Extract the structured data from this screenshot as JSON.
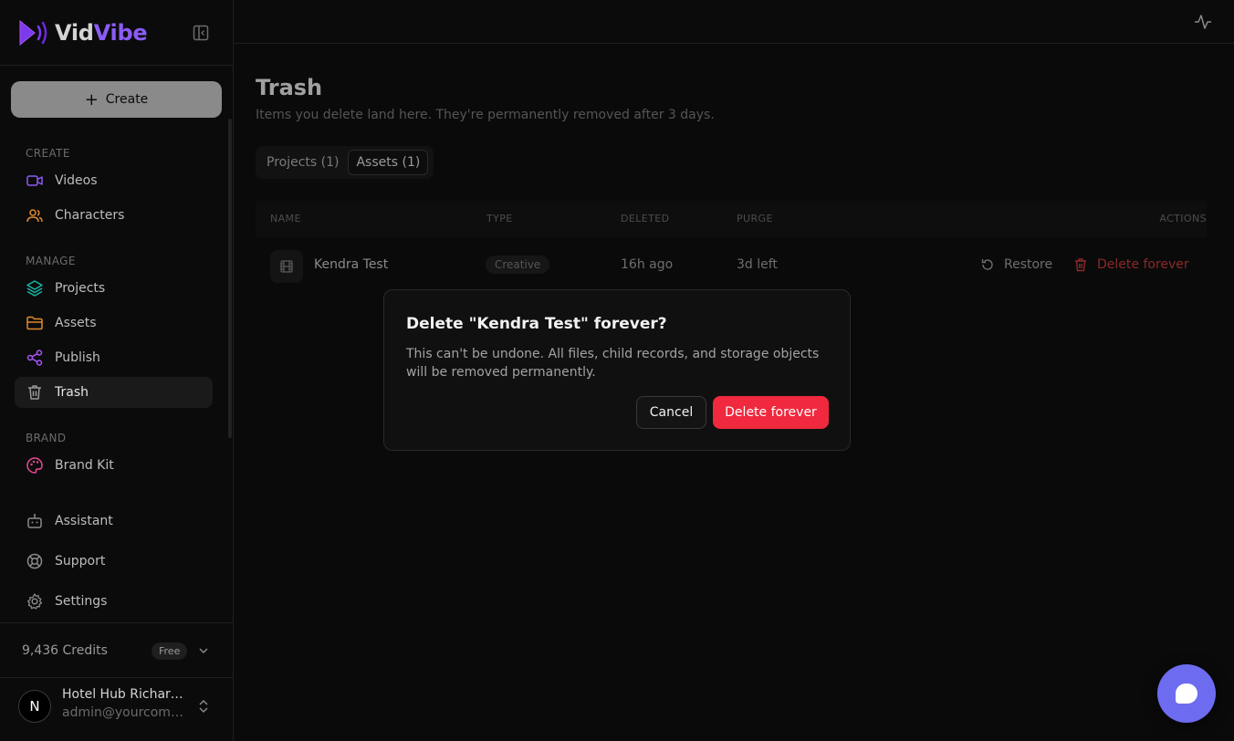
{
  "brand": {
    "name_part1": "Vid",
    "name_part2": "Vibe",
    "accent": "#8b5cf6"
  },
  "sidebar": {
    "create_label": "Create",
    "sections": {
      "create": "CREATE",
      "manage": "MANAGE",
      "brand": "BRAND"
    },
    "items": {
      "videos": {
        "label": "Videos",
        "icon": "video-camera-icon"
      },
      "characters": {
        "label": "Characters",
        "icon": "users-icon"
      },
      "projects": {
        "label": "Projects",
        "icon": "layers-icon"
      },
      "assets": {
        "label": "Assets",
        "icon": "folder-icon"
      },
      "publish": {
        "label": "Publish",
        "icon": "share-icon"
      },
      "trash": {
        "label": "Trash",
        "icon": "trash-icon",
        "active": true
      },
      "brand_kit": {
        "label": "Brand Kit",
        "icon": "palette-icon"
      },
      "assistant": {
        "label": "Assistant",
        "icon": "bot-icon"
      },
      "support": {
        "label": "Support",
        "icon": "lifebuoy-icon"
      },
      "settings": {
        "label": "Settings",
        "icon": "gear-icon"
      }
    },
    "credits": "9,436 Credits",
    "plan": "Free",
    "user": {
      "initial": "N",
      "name": "Hotel Hub Richardson",
      "email": "admin@yourcompany.com"
    }
  },
  "page": {
    "title": "Trash",
    "subtitle": "Items you delete land here. They're permanently removed after 3 days.",
    "tabs": [
      {
        "label": "Projects (1)",
        "active": false
      },
      {
        "label": "Assets (1)",
        "active": true
      }
    ],
    "table": {
      "columns": {
        "name": "NAME",
        "type": "TYPE",
        "deleted": "DELETED",
        "purge": "PURGE",
        "actions": "ACTIONS"
      },
      "rows": [
        {
          "name": "Kendra Test",
          "type": "Creative",
          "deleted": "16h ago",
          "purge": "3d left",
          "restore": "Restore",
          "delete": "Delete forever"
        }
      ]
    }
  },
  "modal": {
    "title": "Delete \"Kendra Test\" forever?",
    "body": "This can't be undone. All files, child records, and storage objects will be removed permanently.",
    "cancel": "Cancel",
    "confirm": "Delete forever",
    "confirm_color": "#f0293e"
  }
}
